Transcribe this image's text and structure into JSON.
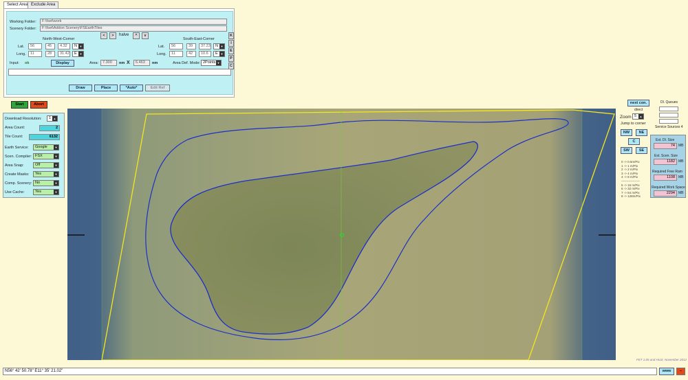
{
  "tabs": [
    "Select Area",
    "Exclude Area"
  ],
  "folders": {
    "working_label": "Working Folder:",
    "working_value": "F:\\fset\\work",
    "scenery_label": "Scenery Folder:",
    "scenery_value": "F:\\fset\\Addon Scenery\\FSEarthTiles"
  },
  "nav": {
    "left": "<",
    "right": ">",
    "halve_label": "halve",
    "up": "^",
    "down": "v"
  },
  "nw": {
    "title": "North-West-Corner",
    "lat_label": "Lat.",
    "lat_deg": "56",
    "lat_min": "45",
    "lat_sec": "4.32",
    "lat_hem": "N",
    "long_label": "Long.",
    "long_deg": "11",
    "long_min": "28",
    "long_sec": "31.42",
    "long_hem": "E"
  },
  "se": {
    "title": "South-East-Corner",
    "lat_label": "Lat.",
    "lat_deg": "56",
    "lat_min": "39",
    "lat_sec": "37.23",
    "lat_hem": "N",
    "long_label": "Long.",
    "long_deg": "11",
    "long_min": "42",
    "long_sec": "10.6",
    "long_hem": "E"
  },
  "letters": [
    "K",
    "I",
    "E",
    "P",
    "C"
  ],
  "input": {
    "label": "Input:",
    "status": "ok",
    "display_btn": "Display"
  },
  "area": {
    "label": "Area:",
    "w": "7.300",
    "w_unit": "nm",
    "x": "X",
    "h": "6.463",
    "h_unit": "nm",
    "mode_label": "Area Def. Mode:",
    "mode_value": "2Points"
  },
  "actions": {
    "draw": "Draw",
    "place": "Place",
    "auto": "*Auto*",
    "edit_ref": "Edit Ref"
  },
  "run": {
    "start": "Start",
    "abort": "Abort"
  },
  "settings": {
    "download_resolution_label": "Download Resolution:",
    "download_resolution_value": "1",
    "area_count_label": "Area Count:",
    "area_count_value": "2",
    "tile_count_label": "Tile Count:",
    "tile_count_value": "6132",
    "earth_service_label": "Earth Service:",
    "earth_service_value": "Google",
    "scen_compiler_label": "Scen. Compiler:",
    "scen_compiler_value": "FSX",
    "area_snap_label": "Area Snap:",
    "area_snap_value": "Off",
    "create_masks_label": "Create Masks:",
    "create_masks_value": "Yes",
    "comp_scenery_label": "Comp. Scenery:",
    "comp_scenery_value": "No",
    "use_cache_label": "Use Cache:",
    "use_cache_value": "Yes"
  },
  "right": {
    "next_con": "next con.",
    "direct": "direct",
    "dl_queues": "Dl. Queues",
    "zoom_label": "Zoom",
    "zoom_value": "5",
    "jump_label": "Jump to corner",
    "nw": "NW",
    "ne": "NE",
    "c": "C",
    "sw": "SW",
    "se": "SE",
    "service_sources": "Service Sources 4",
    "est_dl_label": "Est. Dl. Size",
    "est_dl_value": "74",
    "est_dl_unit": "MB",
    "est_scen_label": "Est. Scen. Size",
    "est_scen_value": "1182",
    "est_scen_unit": "MB",
    "free_ram_label": "Required Free Ram",
    "free_ram_value": "1108",
    "free_ram_unit": "MB",
    "work_space_label": "Required Work Space",
    "work_space_value": "2294",
    "work_space_unit": "MB",
    "res_table": [
      "0  ->  0.5m/Pix",
      "1  ->  1  m/Pix",
      "2  ->  2  m/Pix",
      "3  ->  4  m/Pix",
      "4  ->  8  m/Pix",
      "------------------",
      "5  ->  16 m/Pix",
      "6  ->  32 m/Pix",
      "7  ->  64 m/Pix",
      "8  ->  128m/Pix"
    ]
  },
  "credit": "FET 1.05 and HUJI, November 2012",
  "status": {
    "coords": "N56° 42' 50.78\"    E11° 35' 21.02\"",
    "www": "www"
  },
  "colors": {
    "panel": "#bff0f4",
    "background": "#fdf8d6",
    "start": "#2ea43a",
    "abort": "#e24a1c",
    "area_outline": "#f5e61e",
    "coast_line": "#1c2fc8"
  }
}
